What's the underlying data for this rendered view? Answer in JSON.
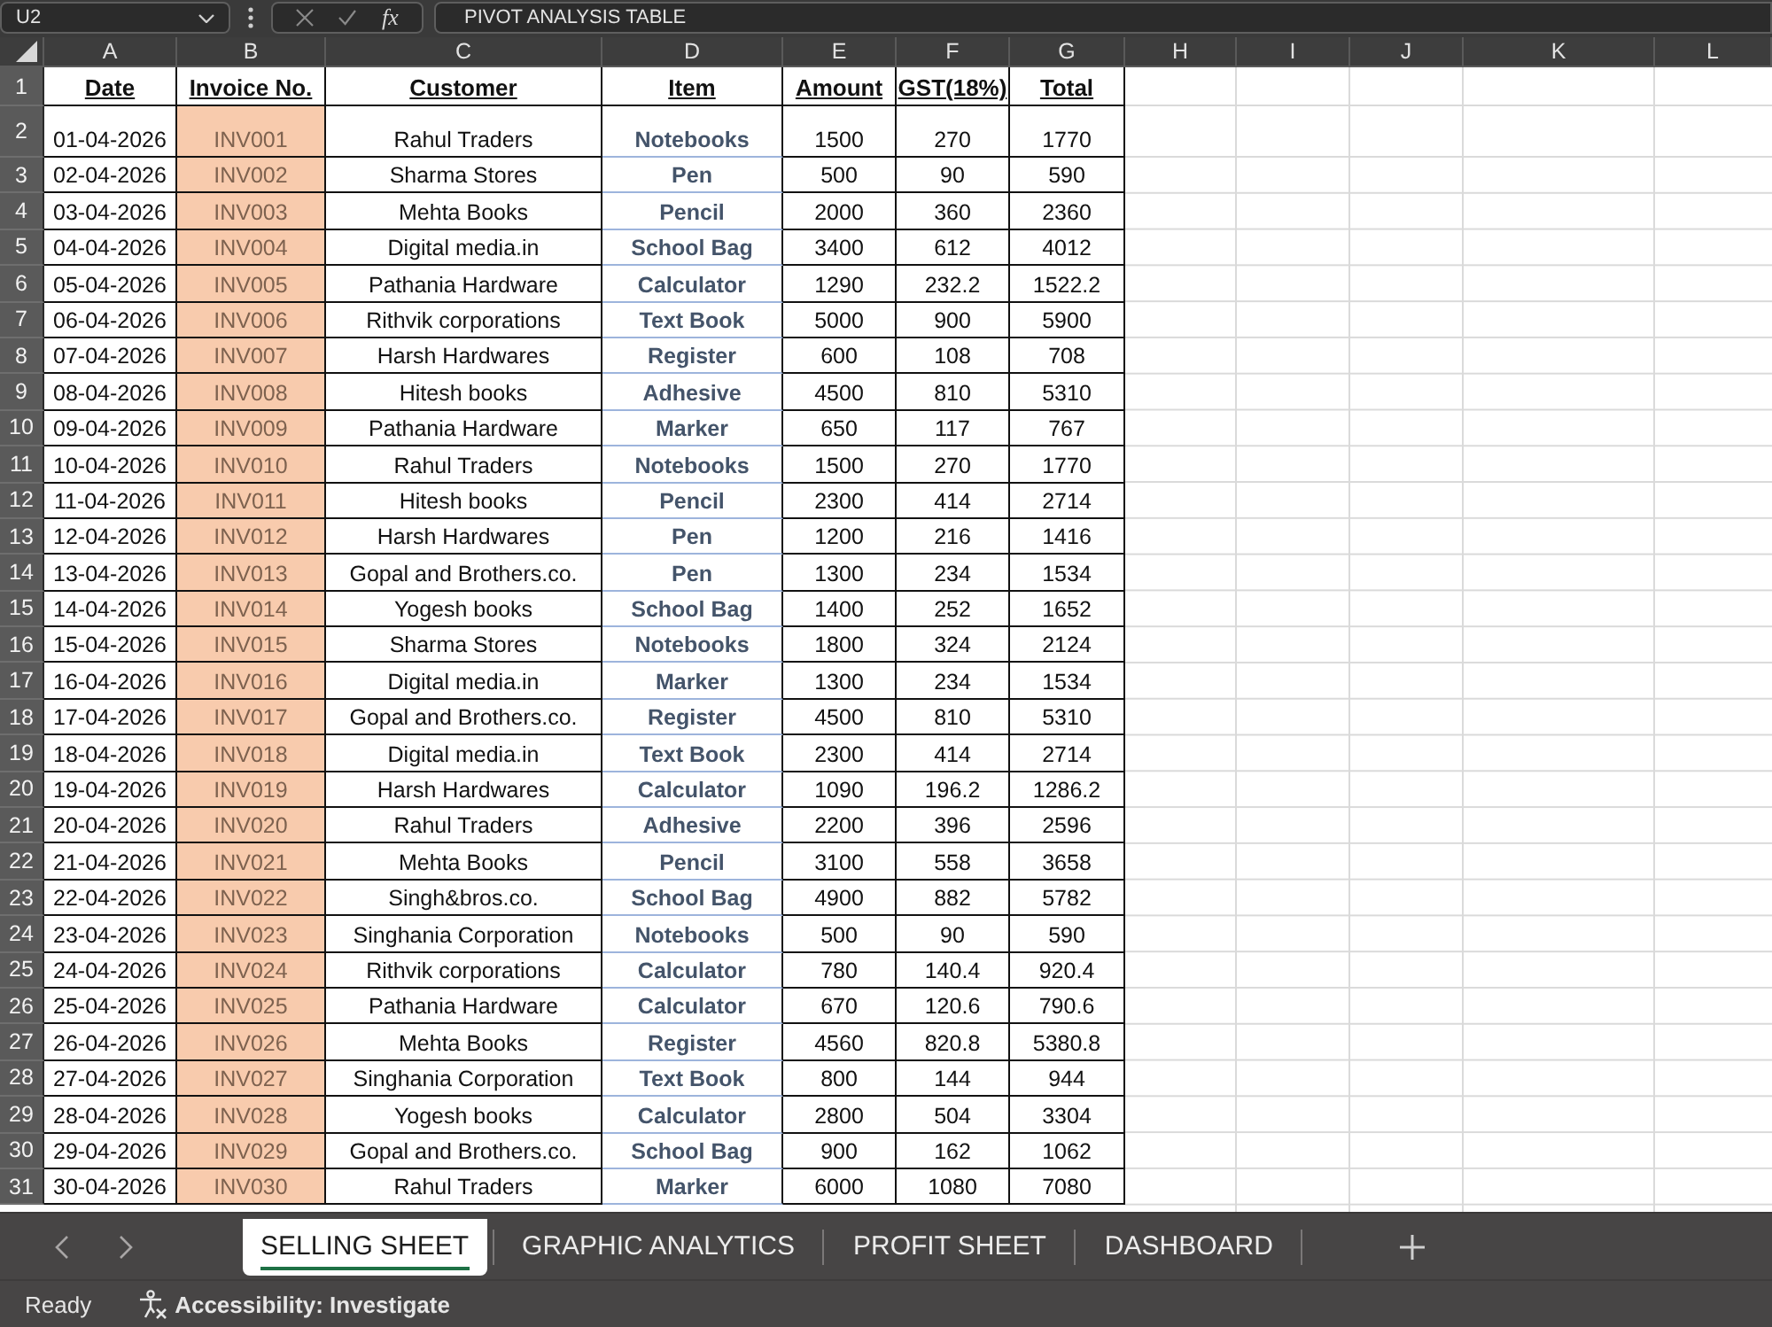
{
  "formula_bar": {
    "name_box": "U2",
    "insert_function": "fx",
    "formula": "PIVOT ANALYSIS TABLE"
  },
  "sheet": {
    "column_headers": [
      "A",
      "B",
      "C",
      "D",
      "E",
      "F",
      "G",
      "H",
      "I",
      "J",
      "K",
      "L"
    ],
    "row_headers": [
      "1",
      "2",
      "3",
      "4",
      "5",
      "6",
      "7",
      "8",
      "9",
      "10",
      "11",
      "12",
      "13",
      "14",
      "15",
      "16",
      "17",
      "18",
      "19",
      "20",
      "21",
      "22",
      "23",
      "24",
      "25",
      "26",
      "27",
      "28",
      "29",
      "30",
      "31"
    ],
    "table": {
      "headers": [
        "Date",
        "Invoice No.",
        "Customer",
        "Item",
        "Amount",
        "GST(18%)",
        "Total"
      ],
      "rows": [
        [
          "01-04-2026",
          "INV001",
          "Rahul Traders",
          "Notebooks",
          "1500",
          "270",
          "1770"
        ],
        [
          "02-04-2026",
          "INV002",
          "Sharma Stores",
          "Pen",
          "500",
          "90",
          "590"
        ],
        [
          "03-04-2026",
          "INV003",
          "Mehta Books",
          "Pencil",
          "2000",
          "360",
          "2360"
        ],
        [
          "04-04-2026",
          "INV004",
          "Digital media.in",
          "School Bag",
          "3400",
          "612",
          "4012"
        ],
        [
          "05-04-2026",
          "INV005",
          "Pathania Hardware",
          "Calculator",
          "1290",
          "232.2",
          "1522.2"
        ],
        [
          "06-04-2026",
          "INV006",
          "Rithvik corporations",
          "Text Book",
          "5000",
          "900",
          "5900"
        ],
        [
          "07-04-2026",
          "INV007",
          "Harsh Hardwares",
          "Register",
          "600",
          "108",
          "708"
        ],
        [
          "08-04-2026",
          "INV008",
          "Hitesh books",
          "Adhesive",
          "4500",
          "810",
          "5310"
        ],
        [
          "09-04-2026",
          "INV009",
          "Pathania Hardware",
          "Marker",
          "650",
          "117",
          "767"
        ],
        [
          "10-04-2026",
          "INV010",
          "Rahul Traders",
          "Notebooks",
          "1500",
          "270",
          "1770"
        ],
        [
          "11-04-2026",
          "INV011",
          "Hitesh books",
          "Pencil",
          "2300",
          "414",
          "2714"
        ],
        [
          "12-04-2026",
          "INV012",
          "Harsh Hardwares",
          "Pen",
          "1200",
          "216",
          "1416"
        ],
        [
          "13-04-2026",
          "INV013",
          "Gopal and Brothers.co.",
          "Pen",
          "1300",
          "234",
          "1534"
        ],
        [
          "14-04-2026",
          "INV014",
          "Yogesh books",
          "School Bag",
          "1400",
          "252",
          "1652"
        ],
        [
          "15-04-2026",
          "INV015",
          "Sharma Stores",
          "Notebooks",
          "1800",
          "324",
          "2124"
        ],
        [
          "16-04-2026",
          "INV016",
          "Digital media.in",
          "Marker",
          "1300",
          "234",
          "1534"
        ],
        [
          "17-04-2026",
          "INV017",
          "Gopal and Brothers.co.",
          "Register",
          "4500",
          "810",
          "5310"
        ],
        [
          "18-04-2026",
          "INV018",
          "Digital media.in",
          "Text Book",
          "2300",
          "414",
          "2714"
        ],
        [
          "19-04-2026",
          "INV019",
          "Harsh Hardwares",
          "Calculator",
          "1090",
          "196.2",
          "1286.2"
        ],
        [
          "20-04-2026",
          "INV020",
          "Rahul Traders",
          "Adhesive",
          "2200",
          "396",
          "2596"
        ],
        [
          "21-04-2026",
          "INV021",
          "Mehta Books",
          "Pencil",
          "3100",
          "558",
          "3658"
        ],
        [
          "22-04-2026",
          "INV022",
          "Singh&bros.co.",
          "School Bag",
          "4900",
          "882",
          "5782"
        ],
        [
          "23-04-2026",
          "INV023",
          "Singhania Corporation",
          "Notebooks",
          "500",
          "90",
          "590"
        ],
        [
          "24-04-2026",
          "INV024",
          "Rithvik corporations",
          "Calculator",
          "780",
          "140.4",
          "920.4"
        ],
        [
          "25-04-2026",
          "INV025",
          "Pathania Hardware",
          "Calculator",
          "670",
          "120.6",
          "790.6"
        ],
        [
          "26-04-2026",
          "INV026",
          "Mehta Books",
          "Register",
          "4560",
          "820.8",
          "5380.8"
        ],
        [
          "27-04-2026",
          "INV027",
          "Singhania Corporation",
          "Text Book",
          "800",
          "144",
          "944"
        ],
        [
          "28-04-2026",
          "INV028",
          "Yogesh books",
          "Calculator",
          "2800",
          "504",
          "3304"
        ],
        [
          "29-04-2026",
          "INV029",
          "Gopal and Brothers.co.",
          "School Bag",
          "900",
          "162",
          "1062"
        ],
        [
          "30-04-2026",
          "INV030",
          "Rahul Traders",
          "Marker",
          "6000",
          "1080",
          "7080"
        ]
      ]
    }
  },
  "sheet_tabs": [
    {
      "label": "SELLING SHEET",
      "selected": true
    },
    {
      "label": "GRAPHIC ANALYTICS",
      "selected": false
    },
    {
      "label": "PROFIT SHEET",
      "selected": false
    },
    {
      "label": "DASHBOARD",
      "selected": false
    }
  ],
  "status_bar": {
    "mode": "Ready",
    "accessibility": "Accessibility: Investigate"
  }
}
